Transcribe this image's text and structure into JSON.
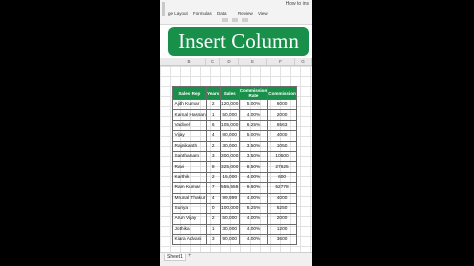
{
  "window": {
    "title_fragment": "How to ins"
  },
  "ribbon": {
    "tabs": [
      "ge Layout",
      "Formulas",
      "Data",
      "Review",
      "View"
    ]
  },
  "banner": {
    "text": "Insert Column"
  },
  "column_headers": [
    "B",
    "C",
    "D",
    "E",
    "F",
    "G"
  ],
  "table": {
    "headers": [
      "Sales Rep",
      "Years",
      "Sales",
      "Commission Rate",
      "Commission"
    ],
    "rows": [
      [
        "Ajith Kumar",
        "2",
        "120,000",
        "5.00%",
        "6000"
      ],
      [
        "Kamal Hassan",
        "1",
        "50,000",
        "4.00%",
        "2000"
      ],
      [
        "Vadivel",
        "6",
        "105,000",
        "6.25%",
        "6563"
      ],
      [
        "Vijay",
        "4",
        "80,000",
        "5.00%",
        "4000"
      ],
      [
        "Rajnikanth",
        "2",
        "30,000",
        "3.50%",
        "1050"
      ],
      [
        "Santhanam",
        "3",
        "300,000",
        "3.50%",
        "10500"
      ],
      [
        "Ravi",
        "8",
        "325,000",
        "8.50%",
        "27625"
      ],
      [
        "Karthik",
        "2",
        "15,000",
        "4.00%",
        "600"
      ],
      [
        "Ram Kumar",
        "7",
        "555,555",
        "9.50%",
        "52778"
      ],
      [
        "Mrunal Thakur",
        "4",
        "99,999",
        "4.00%",
        "4000"
      ],
      [
        "Suriya",
        "0",
        "100,000",
        "6.25%",
        "6250"
      ],
      [
        "Arun Vijay",
        "2",
        "50,000",
        "4.00%",
        "2000"
      ],
      [
        "Jothika",
        "1",
        "30,000",
        "4.00%",
        "1200"
      ],
      [
        "Kiara Advani",
        "3",
        "90,000",
        "4.00%",
        "3600"
      ]
    ]
  },
  "sheet_tabs": {
    "active": "Sheet1",
    "add": "+"
  },
  "colors": {
    "banner": "#18904a",
    "header_fill": "#18904a",
    "background": "#000000"
  }
}
